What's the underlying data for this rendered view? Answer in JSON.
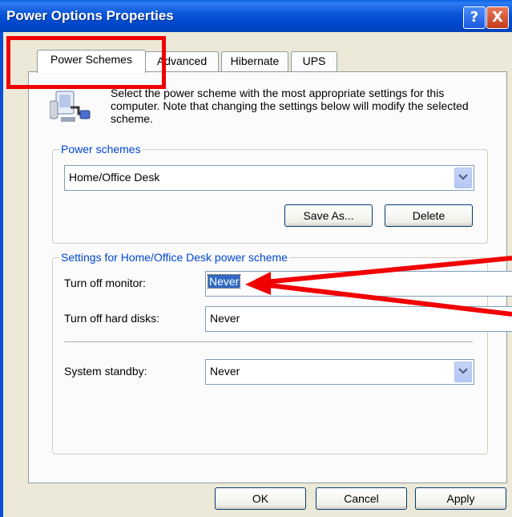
{
  "window": {
    "title": "Power Options Properties",
    "help_label": "?",
    "close_label": "X"
  },
  "tabs": [
    {
      "label": "Power Schemes",
      "selected": true
    },
    {
      "label": "Advanced",
      "selected": false
    },
    {
      "label": "Hibernate",
      "selected": false
    },
    {
      "label": "UPS",
      "selected": false
    }
  ],
  "description": "Select the power scheme with the most appropriate settings for this computer. Note that changing the settings below will modify the selected scheme.",
  "power_schemes": {
    "legend": "Power schemes",
    "selected": "Home/Office Desk",
    "save_as_label": "Save As...",
    "delete_label": "Delete"
  },
  "settings": {
    "legend": "Settings for Home/Office Desk power scheme",
    "monitor_label": "Turn off monitor:",
    "monitor_value": "Never",
    "disks_label": "Turn off hard disks:",
    "disks_value": "Never",
    "standby_label": "System standby:",
    "standby_value": "Never"
  },
  "footer": {
    "ok_label": "OK",
    "cancel_label": "Cancel",
    "apply_label": "Apply"
  },
  "colors": {
    "annotation": "#f00000",
    "titlebar": "#0054e3",
    "selection": "#316ac5"
  }
}
